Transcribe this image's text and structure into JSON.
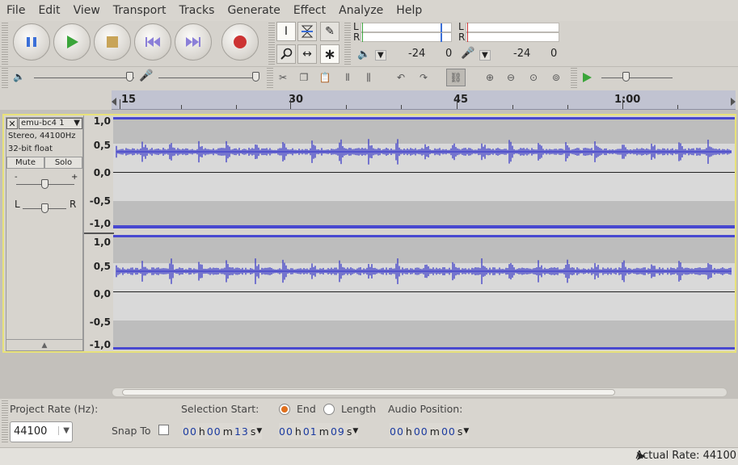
{
  "menubar": {
    "items": [
      "File",
      "Edit",
      "View",
      "Transport",
      "Tracks",
      "Generate",
      "Effect",
      "Analyze",
      "Help"
    ]
  },
  "transport": {
    "buttons": [
      {
        "name": "pause-button",
        "icon": "pause-icon",
        "color": "#3b6fd8"
      },
      {
        "name": "play-button",
        "icon": "play-icon",
        "color": "#3aa53a"
      },
      {
        "name": "stop-button",
        "icon": "stop-icon",
        "color": "#c8a458"
      },
      {
        "name": "skip-start-button",
        "icon": "skip-start-icon",
        "color": "#8b7fd8"
      },
      {
        "name": "skip-end-button",
        "icon": "skip-end-icon",
        "color": "#8b7fd8"
      },
      {
        "name": "record-button",
        "icon": "record-icon",
        "color": "#cc3333"
      }
    ]
  },
  "tools": {
    "selection": "selection-tool-icon",
    "envelope": "envelope-tool-icon",
    "draw": "draw-tool-icon",
    "zoom": "zoom-tool-icon",
    "timeshift": "timeshift-tool-icon",
    "multi": "multi-tool-icon"
  },
  "meters": {
    "playback": {
      "left": "L",
      "right": "R",
      "db1": "-24",
      "db2": "0"
    },
    "record": {
      "left": "L",
      "right": "R",
      "db1": "-24",
      "db2": "0"
    }
  },
  "ruler": {
    "labels": [
      "15",
      "30",
      "45",
      "1:00"
    ]
  },
  "track": {
    "name": "emu-bc4 1",
    "format_line1": "Stereo, 44100Hz",
    "format_line2": "32-bit float",
    "mute": "Mute",
    "solo": "Solo",
    "pan_left": "L",
    "pan_right": "R",
    "gain_minus": "-",
    "gain_plus": "+",
    "scale_labels": [
      "1,0",
      "0,5",
      "0,0",
      "-0,5",
      "-1,0"
    ]
  },
  "selection_bar": {
    "project_rate_label": "Project Rate (Hz):",
    "project_rate_value": "44100",
    "snap_to_label": "Snap To",
    "selection_start_label": "Selection Start:",
    "end_label": "End",
    "length_label": "Length",
    "audio_position_label": "Audio Position:",
    "selection_start": {
      "h": "00",
      "m": "00",
      "s": "13"
    },
    "selection_end": {
      "h": "00",
      "m": "01",
      "s": "09"
    },
    "audio_position": {
      "h": "00",
      "m": "00",
      "s": "00"
    },
    "unit_h": "h",
    "unit_m": "m",
    "unit_s": "s"
  },
  "status": {
    "actual_rate": "Actual Rate: 44100"
  },
  "colors": {
    "waveform": "#3232c8",
    "track_border": "#e8e27a",
    "record_radio": "#e0701e"
  }
}
